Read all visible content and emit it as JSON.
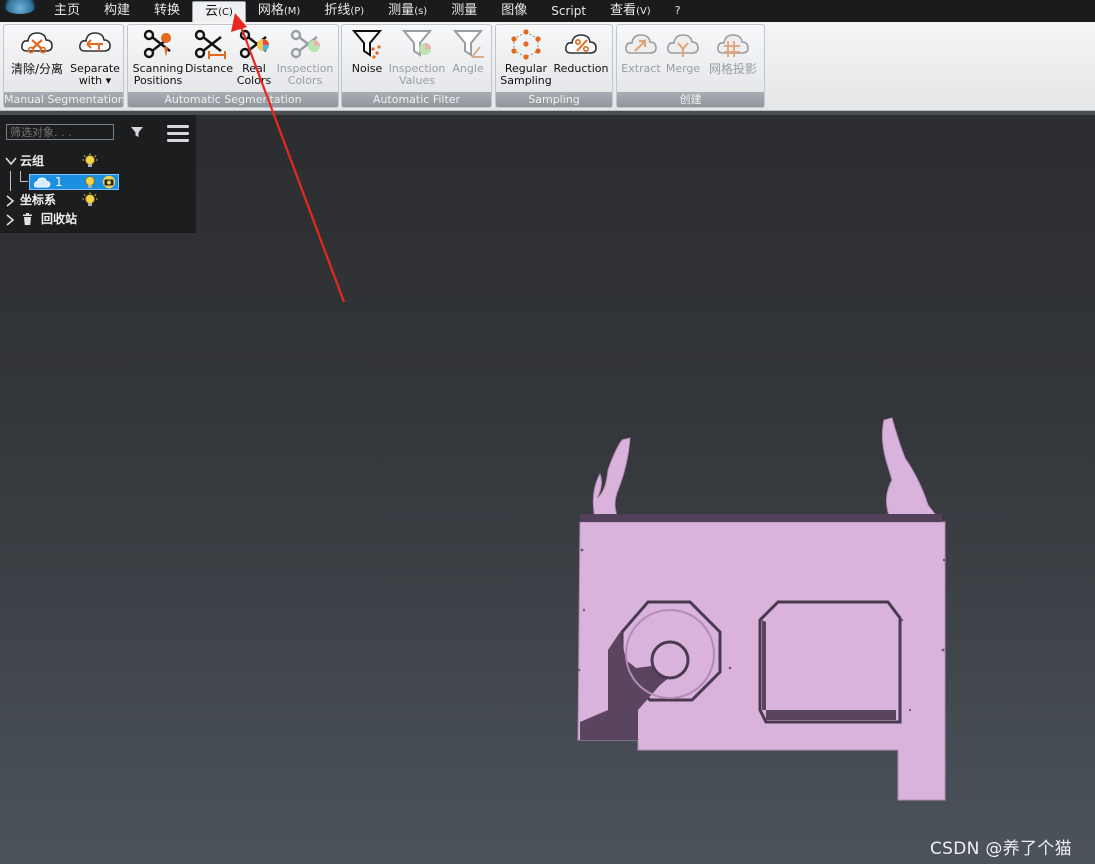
{
  "menubar": {
    "tabs": [
      {
        "label": "主页",
        "shortcut": ""
      },
      {
        "label": "构建",
        "shortcut": ""
      },
      {
        "label": "转换",
        "shortcut": ""
      },
      {
        "label": "云",
        "shortcut": "(C)"
      },
      {
        "label": "网格",
        "shortcut": "(M)"
      },
      {
        "label": "折线",
        "shortcut": "(P)"
      },
      {
        "label": "测量",
        "shortcut": "(s)"
      },
      {
        "label": "测量",
        "shortcut": ""
      },
      {
        "label": "图像",
        "shortcut": ""
      },
      {
        "label": "Script",
        "shortcut": ""
      },
      {
        "label": "查看",
        "shortcut": "(V)"
      },
      {
        "label": "?",
        "shortcut": ""
      }
    ],
    "active_tab": "云"
  },
  "ribbon": {
    "manual_segmentation": {
      "title": "Manual Segmentation",
      "clear_label": "清除/分离",
      "separate_label_1": "Separate",
      "separate_label_2": "with ▾"
    },
    "automatic_segmentation": {
      "title": "Automatic Segmentation",
      "scanning_1": "Scanning",
      "scanning_2": "Positions",
      "distance": "Distance",
      "real_1": "Real",
      "real_2": "Colors",
      "inspection_1": "Inspection",
      "inspection_2": "Colors"
    },
    "automatic_filter": {
      "title": "Automatic Filter",
      "noise": "Noise",
      "inspection_1": "Inspection",
      "inspection_2": "Values",
      "angle": "Angle"
    },
    "sampling": {
      "title": "Sampling",
      "regular_1": "Regular",
      "regular_2": "Sampling",
      "reduction": "Reduction"
    },
    "create": {
      "title": "创建",
      "extract": "Extract",
      "merge": "Merge",
      "mesh_projection": "网格投影"
    }
  },
  "panel": {
    "filter_placeholder": "筛选对象. . .",
    "tree": {
      "cloud_group": "云组",
      "cloud_item": "1",
      "coordinate_system": "坐标系",
      "recycle_bin": "回收站"
    }
  },
  "watermark": "CSDN @养了个猫",
  "colors": {
    "point_cloud": "#d9b3dc",
    "selection": "#1b8fe0",
    "arrow": "#e8281e",
    "accent_orange": "#e36a1d"
  }
}
